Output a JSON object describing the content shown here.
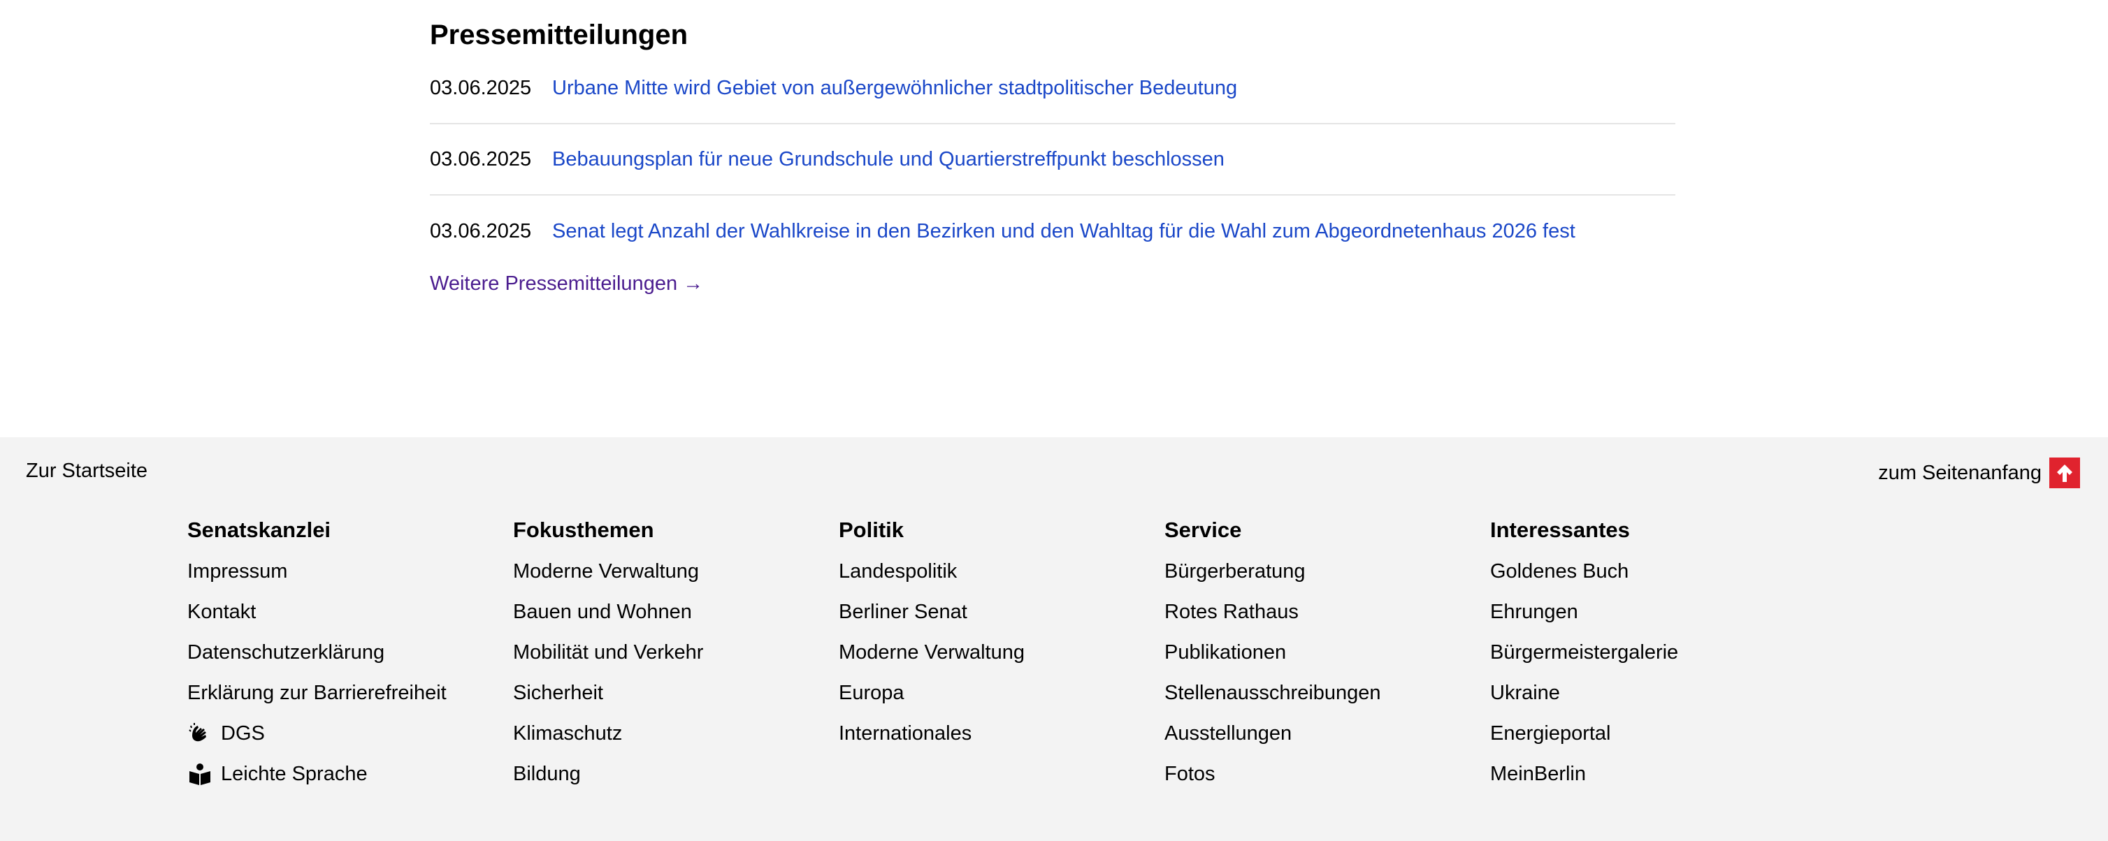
{
  "press": {
    "heading": "Pressemitteilungen",
    "items": [
      {
        "date": "03.06.2025",
        "title": "Urbane Mitte wird Gebiet von außergewöhnlicher stadtpolitischer Bedeutung"
      },
      {
        "date": "03.06.2025",
        "title": "Bebauungsplan für neue Grundschule und Quartierstreffpunkt beschlossen"
      },
      {
        "date": "03.06.2025",
        "title": "Senat legt Anzahl der Wahlkreise in den Bezirken und den Wahltag für die Wahl zum Abgeordnetenhaus 2026 fest"
      }
    ],
    "more_label": "Weitere Pressemitteilungen",
    "more_arrow": "→"
  },
  "footer": {
    "home_label": "Zur Startseite",
    "top_label": "zum Seitenanfang",
    "accent_color": "#e0232e",
    "columns": [
      {
        "heading": "Senatskanzlei",
        "links": [
          "Impressum",
          "Kontakt",
          "Datenschutzerklärung",
          "Erklärung zur Barrierefreiheit",
          "DGS",
          "Leichte Sprache"
        ]
      },
      {
        "heading": "Fokusthemen",
        "links": [
          "Moderne Verwaltung",
          "Bauen und Wohnen",
          "Mobilität und Verkehr",
          "Sicherheit",
          "Klimaschutz",
          "Bildung"
        ]
      },
      {
        "heading": "Politik",
        "links": [
          "Landespolitik",
          "Berliner Senat",
          "Moderne Verwaltung",
          "Europa",
          "Internationales"
        ]
      },
      {
        "heading": "Service",
        "links": [
          "Bürgerberatung",
          "Rotes Rathaus",
          "Publikationen",
          "Stellenausschreibungen",
          "Ausstellungen",
          "Fotos"
        ]
      },
      {
        "heading": "Interessantes",
        "links": [
          "Goldenes Buch",
          "Ehrungen",
          "Bürgermeistergalerie",
          "Ukraine",
          "Energieportal",
          "MeinBerlin"
        ]
      }
    ],
    "icons": {
      "dgs": "sign-language-icon",
      "leichte_sprache": "easy-language-icon",
      "to_top": "arrow-up-icon"
    }
  }
}
